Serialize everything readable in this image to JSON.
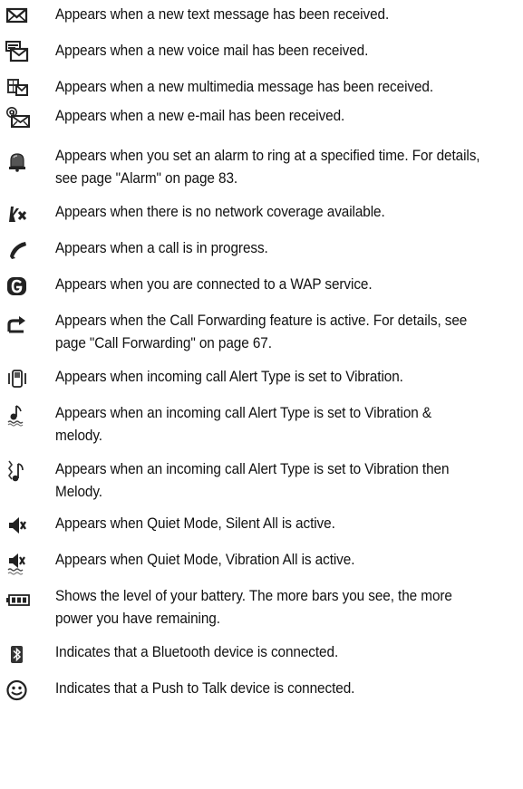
{
  "rows": [
    {
      "icon": "new-text-message-icon",
      "text": "Appears when a new text message has been received."
    },
    {
      "icon": "new-voice-mail-icon",
      "text": "Appears when a new voice mail has been received."
    },
    {
      "icon": "new-multimedia-message-icon",
      "text": "Appears when a new multimedia message has been received."
    },
    {
      "icon": "new-email-icon",
      "text": "Appears when a new e-mail has been received."
    },
    {
      "icon": "alarm-bell-icon",
      "text": "Appears when you set an alarm to ring at a specified time. For details, see page \"Alarm\" on page 83."
    },
    {
      "icon": "no-network-coverage-icon",
      "text": "Appears when there is no network coverage available."
    },
    {
      "icon": "call-in-progress-icon",
      "text": "Appears when a call is in progress."
    },
    {
      "icon": "wap-service-icon",
      "text": "Appears when you are connected to a WAP service."
    },
    {
      "icon": "call-forwarding-icon",
      "text": "Appears when the Call Forwarding feature is active. For details, see page \"Call Forwarding\" on page 67."
    },
    {
      "icon": "vibration-alert-icon",
      "text": "Appears when incoming call Alert Type is set to Vibration."
    },
    {
      "icon": "vibration-and-melody-icon",
      "text": "Appears when an incoming call Alert Type is set to Vibration & melody."
    },
    {
      "icon": "vibration-then-melody-icon",
      "text": "Appears when an incoming call Alert Type is set to Vibration then Melody."
    },
    {
      "icon": "silent-all-icon",
      "text": "Appears when Quiet Mode, Silent All is active."
    },
    {
      "icon": "vibration-all-icon",
      "text": "Appears when Quiet Mode, Vibration All is active."
    },
    {
      "icon": "battery-level-icon",
      "text": "Shows the level of your battery. The more bars you see, the more power you have remaining."
    },
    {
      "icon": "bluetooth-icon",
      "text": "Indicates that a Bluetooth device is connected."
    },
    {
      "icon": "push-to-talk-icon",
      "text": "Indicates that a Push to Talk device is connected."
    }
  ]
}
